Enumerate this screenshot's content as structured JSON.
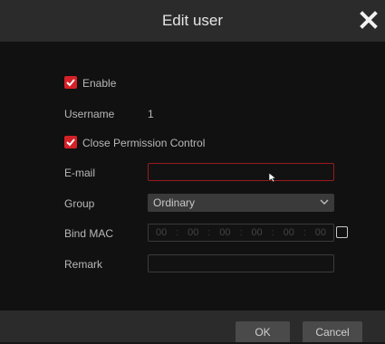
{
  "dialog": {
    "title": "Edit user"
  },
  "form": {
    "enable_label": "Enable",
    "enable_checked": true,
    "username_label": "Username",
    "username_value": "1",
    "close_permission_label": "Close Permission Control",
    "close_permission_checked": true,
    "email_label": "E-mail",
    "email_value": "",
    "group_label": "Group",
    "group_value": "Ordinary",
    "bind_mac_label": "Bind MAC",
    "mac_octets": [
      "00",
      "00",
      "00",
      "00",
      "00",
      "00"
    ],
    "mac_separator": ":",
    "bind_mac_checked": false,
    "remark_label": "Remark",
    "remark_value": ""
  },
  "buttons": {
    "ok": "OK",
    "cancel": "Cancel"
  },
  "icons": {
    "close": "close-icon",
    "check": "checkmark-icon",
    "dropdown": "chevron-down-icon",
    "pointer": "mouse-pointer-icon"
  },
  "colors": {
    "accent": "#d42127",
    "titlebar": "#2b2b2b",
    "background": "#111111",
    "focus_border": "#9a1a1e"
  }
}
